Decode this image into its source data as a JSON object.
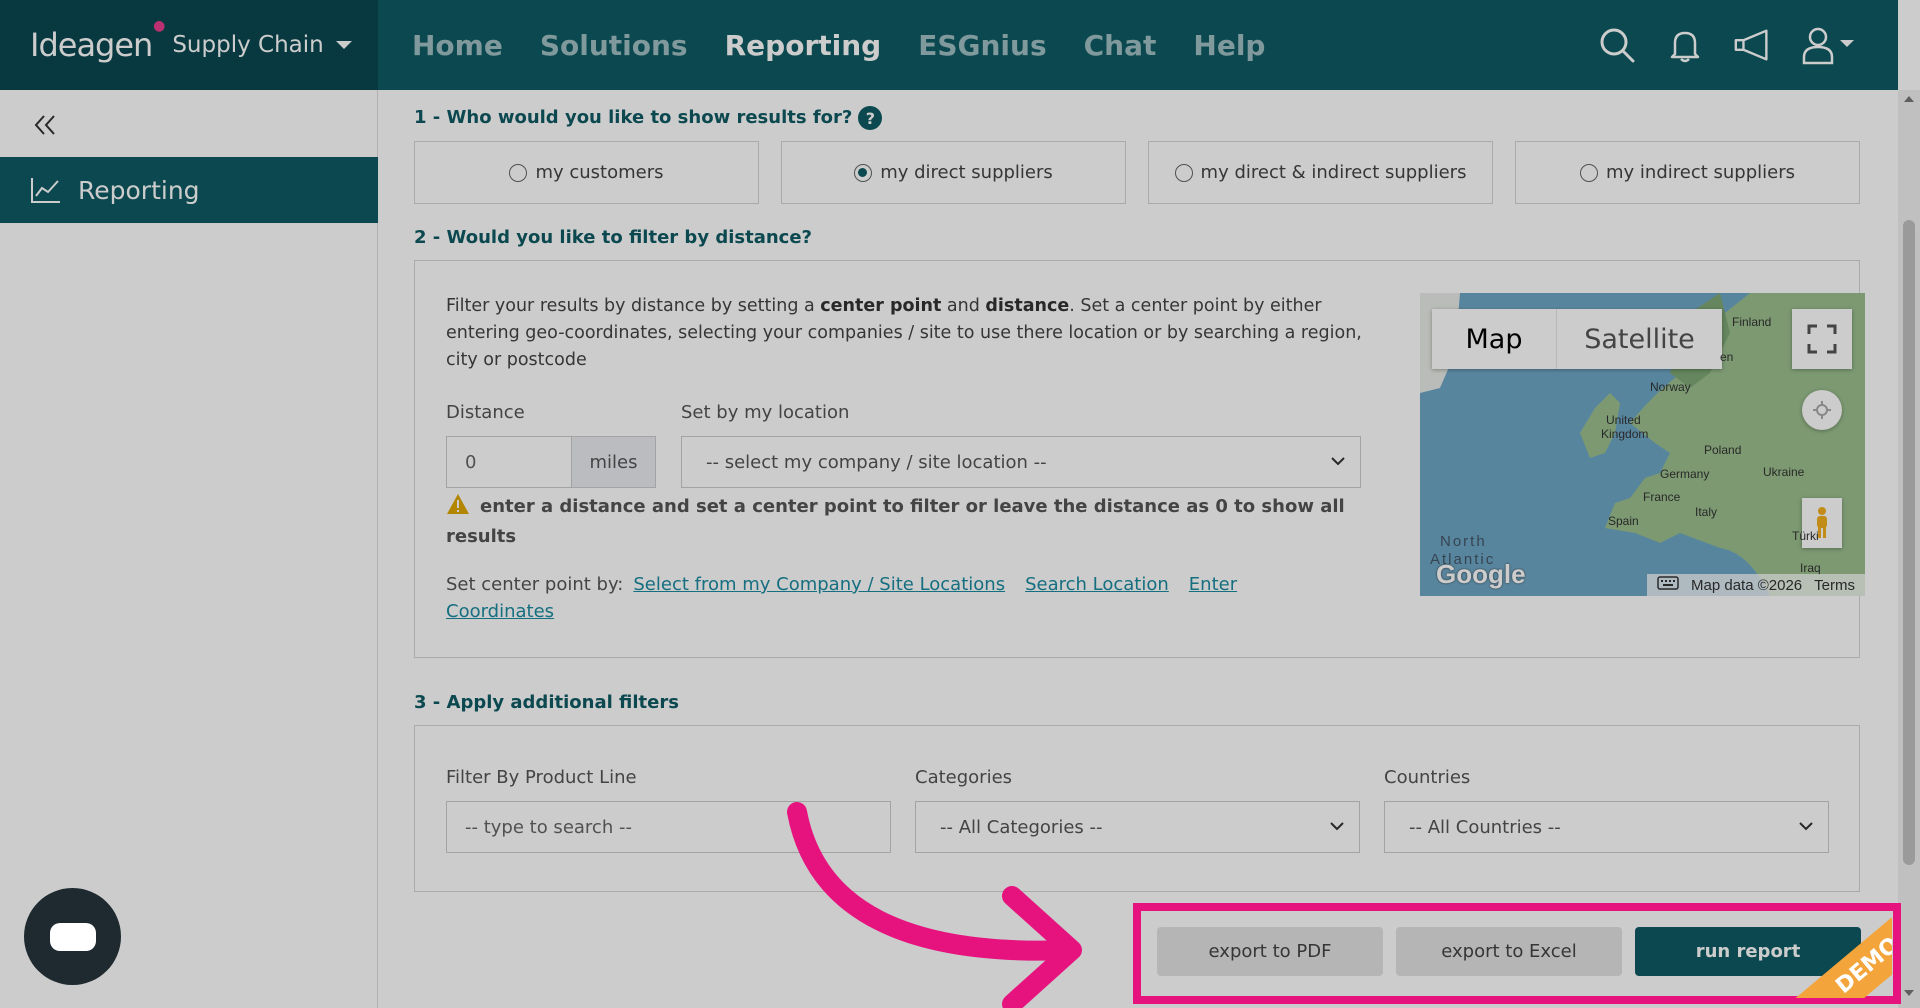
{
  "brand": {
    "logo": "Ideagen",
    "product": "Supply Chain"
  },
  "nav": [
    {
      "label": "Home"
    },
    {
      "label": "Solutions"
    },
    {
      "label": "Reporting"
    },
    {
      "label": "ESGnius"
    },
    {
      "label": "Chat"
    },
    {
      "label": "Help"
    }
  ],
  "sidebar": {
    "items": [
      {
        "label": "Reporting",
        "icon": "chart-line-icon"
      }
    ]
  },
  "section1": {
    "title": "1 - Who would you like to show results for?",
    "help": "?",
    "options": [
      {
        "label": "my customers",
        "checked": false
      },
      {
        "label": "my direct suppliers",
        "checked": true
      },
      {
        "label": "my direct & indirect suppliers",
        "checked": false
      },
      {
        "label": "my indirect suppliers",
        "checked": false
      }
    ]
  },
  "section2": {
    "title": "2 - Would you like to filter by distance?",
    "intro": [
      "Filter your results by distance by setting a ",
      "center point",
      " and ",
      "distance",
      ". Set a center point by either entering geo-coordinates, selecting your companies / site to use there location or by searching a region, city or postcode"
    ],
    "distance_label": "Distance",
    "distance_value": "0",
    "distance_unit": "miles",
    "location_label": "Set by my location",
    "location_select": "-- select my company / site location --",
    "warning": "enter a distance and set a center point to filter or leave the distance as 0 to show all results",
    "center_prefix": "Set center point by:",
    "center_links": [
      "Select from my Company / Site Locations",
      "Search Location",
      "Enter",
      "Coordinates"
    ],
    "map": {
      "tabs": [
        "Map",
        "Satellite"
      ],
      "labels": [
        "Finland",
        "Norway",
        "United",
        "Kingdom",
        "Poland",
        "Germany",
        "Ukraine",
        "France",
        "Italy",
        "Spain",
        "Türki",
        "Iraq",
        "North",
        "Atlantic",
        "en"
      ],
      "brand": "Google",
      "data_text": "Map data ©2026",
      "terms": "Terms",
      "water_color": "#6fa7c6",
      "land_color": "#9cc08f"
    }
  },
  "section3": {
    "title": "3 - Apply additional filters",
    "product_label": "Filter By Product Line",
    "product_placeholder": "-- type to search --",
    "categories_label": "Categories",
    "categories_select": "-- All Categories --",
    "countries_label": "Countries",
    "countries_select": "-- All Countries --"
  },
  "actions": {
    "export_pdf": "export to PDF",
    "export_excel": "export to Excel",
    "run_report": "run report",
    "demo": "DEMO"
  },
  "colors": {
    "primary": "#0e5b63",
    "brand_dark": "#0a4850",
    "highlight": "#e6137f",
    "link": "#1b8ba0",
    "warning": "#e0a800",
    "demo": "#f3a43b"
  }
}
